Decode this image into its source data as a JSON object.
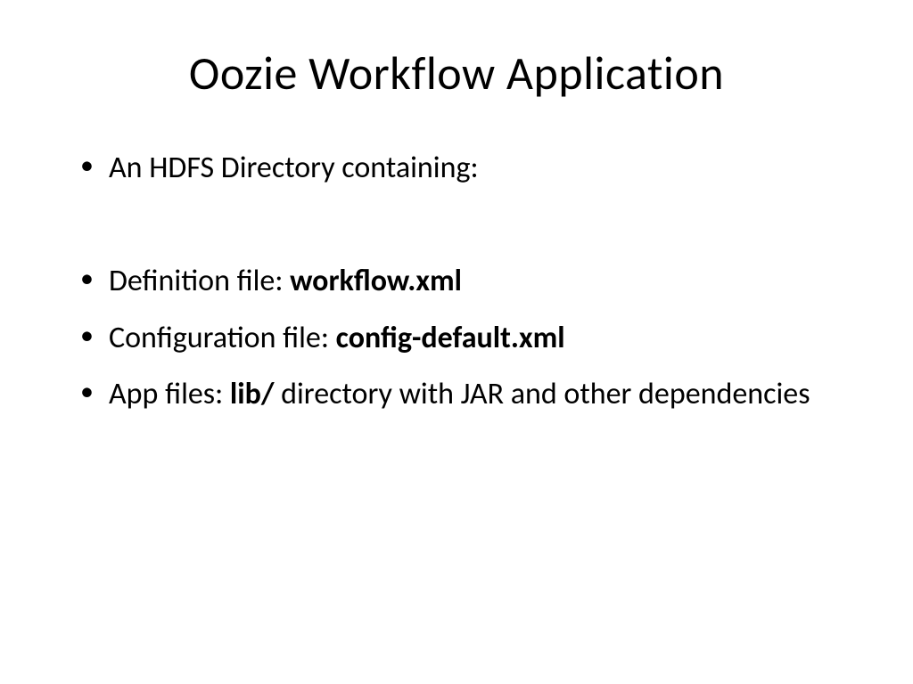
{
  "slide": {
    "title": "Oozie Workflow Application",
    "bullets": [
      {
        "segments": [
          {
            "text": "An HDFS Directory containing:",
            "bold": false
          }
        ]
      },
      {
        "spacer": true
      },
      {
        "segments": [
          {
            "text": "Definition file: ",
            "bold": false
          },
          {
            "text": "workflow.xml",
            "bold": true
          }
        ]
      },
      {
        "segments": [
          {
            "text": "Configuration file: ",
            "bold": false
          },
          {
            "text": "config-default.xml",
            "bold": true
          }
        ]
      },
      {
        "segments": [
          {
            "text": "App files: ",
            "bold": false
          },
          {
            "text": "lib/",
            "bold": true
          },
          {
            "text": " directory with JAR and other dependencies",
            "bold": false
          }
        ]
      }
    ]
  }
}
